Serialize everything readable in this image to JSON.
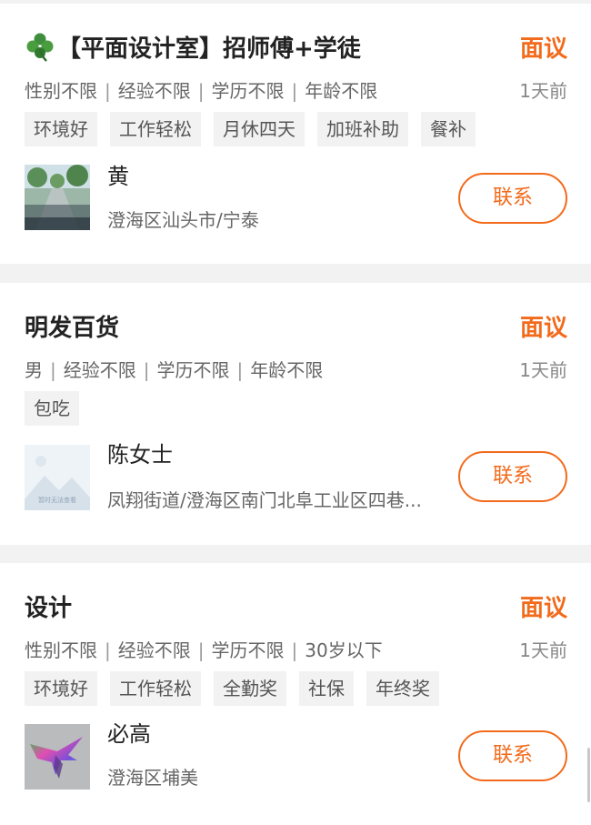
{
  "jobs": [
    {
      "title": "【平面设计室】招师傅+学徒",
      "salary": "面议",
      "requirements": [
        "性别不限",
        "经验不限",
        "学历不限",
        "年龄不限"
      ],
      "posted": "1天前",
      "tags": [
        "环境好",
        "工作轻松",
        "月休四天",
        "加班补助",
        "餐补"
      ],
      "contact_name": "黄",
      "address": "澄海区汕头市/宁泰",
      "contact_label": "联系",
      "icon": "clover-icon"
    },
    {
      "title": "明发百货",
      "salary": "面议",
      "requirements": [
        "男",
        "经验不限",
        "学历不限",
        "年龄不限"
      ],
      "posted": "1天前",
      "tags": [
        "包吃"
      ],
      "contact_name": "陈女士",
      "address": "凤翔街道/澄海区南门北阜工业区四巷...",
      "contact_label": "联系",
      "avatar_placeholder": "暂时无法查看"
    },
    {
      "title": "设计",
      "salary": "面议",
      "requirements": [
        "性别不限",
        "经验不限",
        "学历不限",
        "30岁以下"
      ],
      "posted": "1天前",
      "tags": [
        "环境好",
        "工作轻松",
        "全勤奖",
        "社保",
        "年终奖"
      ],
      "contact_name": "必高",
      "address": "澄海区埔美",
      "contact_label": "联系"
    }
  ],
  "colors": {
    "accent": "#f26a1b",
    "tag_bg": "#f2f2f2",
    "page_bg": "#f2f2f2"
  }
}
